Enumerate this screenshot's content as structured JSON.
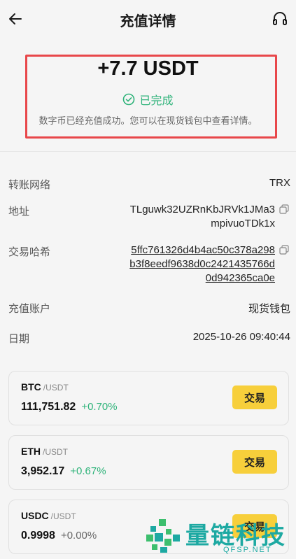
{
  "header": {
    "title": "充值详情",
    "back_icon": "arrow-left-icon",
    "support_icon": "headset-icon"
  },
  "summary": {
    "amount": "+7.7 USDT",
    "status": "已完成",
    "status_color": "#2fb37a",
    "description": "数字币已经充值成功。您可以在现货钱包中查看详情。"
  },
  "details": {
    "network_label": "转账网络",
    "network_value": "TRX",
    "address_label": "地址",
    "address_line1": "TLguwk32UZRnKbJRVk1JMa3",
    "address_line2": "mpivuoTDk1x",
    "hash_label": "交易哈希",
    "hash_line1": "5ffc761326d4b4ac50c378a298",
    "hash_line2": "b3f8eedf9638d0c2421435766d",
    "hash_line3": "0d942365ca0e",
    "account_label": "充值账户",
    "account_value": "现货钱包",
    "date_label": "日期",
    "date_value": "2025-10-26 09:40:44"
  },
  "markets": [
    {
      "base": "BTC",
      "quote": "/USDT",
      "price": "111,751.82",
      "change": "+0.70%",
      "trend": "up",
      "button": "交易"
    },
    {
      "base": "ETH",
      "quote": "/USDT",
      "price": "3,952.17",
      "change": "+0.67%",
      "trend": "up",
      "button": "交易"
    },
    {
      "base": "USDC",
      "quote": "/USDT",
      "price": "0.9998",
      "change": "+0.00%",
      "trend": "flat",
      "button": "交易"
    }
  ],
  "watermark": {
    "brand": "量链科技",
    "domain": "QFSP.NET"
  },
  "colors": {
    "accent_yellow": "#f7cf3b",
    "positive_green": "#2fb37a",
    "highlight_red": "#e8474a"
  }
}
